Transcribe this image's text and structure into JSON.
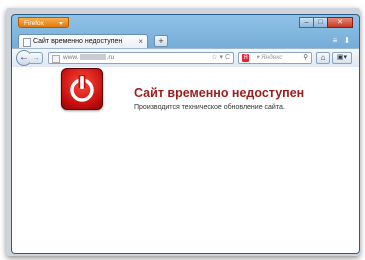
{
  "browser": {
    "menu_button": "Firefox",
    "window_controls": {
      "minimize": "–",
      "maximize": "□",
      "close": "✕"
    }
  },
  "tab": {
    "title": "Сайт временно недоступен",
    "close": "×"
  },
  "new_tab": "+",
  "toolbar": {
    "back": "←",
    "forward": "→",
    "url_prefix": "www.",
    "url_suffix": ".ru",
    "url_icons": "☆ ▾ C",
    "search_engine": "Я",
    "search_placeholder": "▾ Яндекс",
    "search_icon": "⚲",
    "home": "⌂",
    "menu": "▣▾"
  },
  "page": {
    "error_title": "Сайт временно недоступен",
    "error_message": "Производится техническое обновление сайта."
  },
  "colors": {
    "accent_orange": "#e07a10",
    "error_red": "#9c1d1d",
    "window_blue": "#6ea6d4"
  }
}
